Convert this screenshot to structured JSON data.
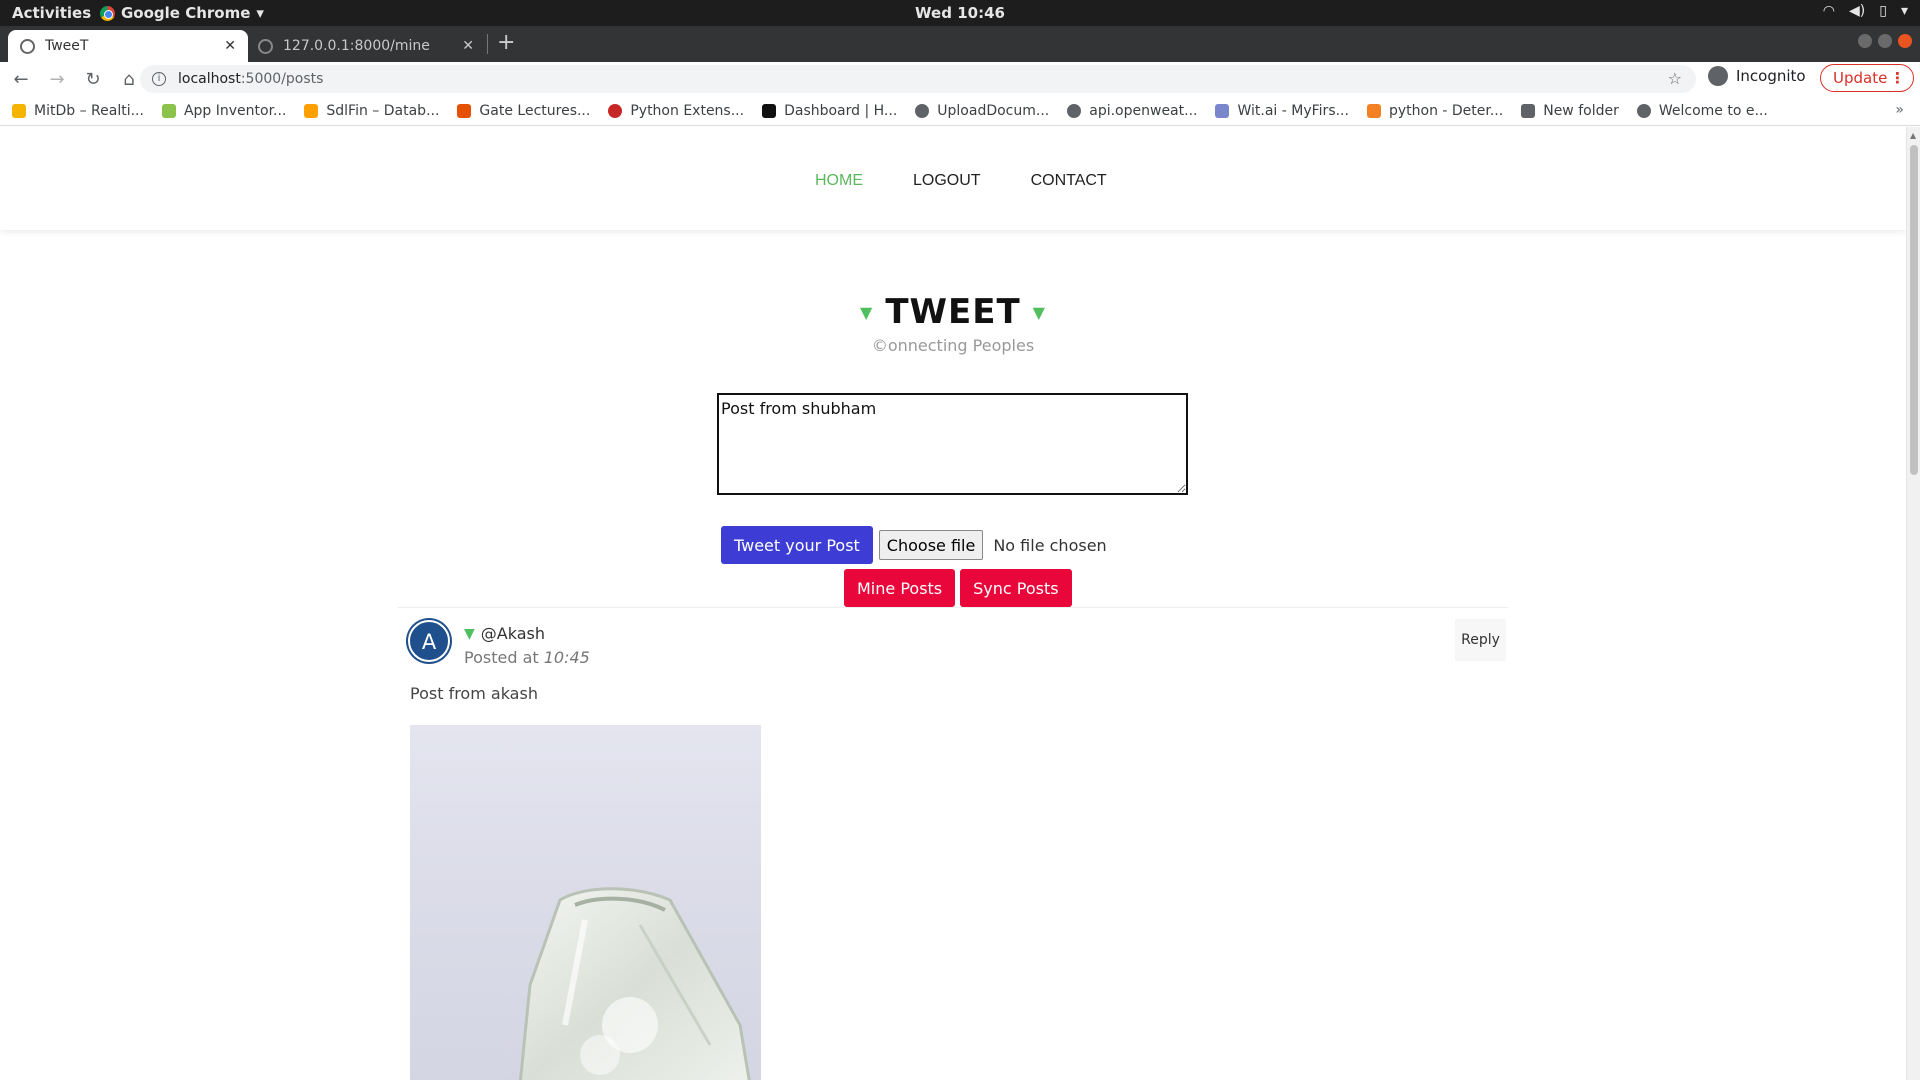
{
  "system": {
    "activities": "Activities",
    "app_name": "Google Chrome",
    "clock": "Wed 10:46"
  },
  "tabs": [
    {
      "label": "TweeT",
      "active": true
    },
    {
      "label": "127.0.0.1:8000/mine",
      "active": false
    }
  ],
  "toolbar": {
    "url_host": "localhost",
    "url_path": ":5000/posts",
    "incognito_label": "Incognito",
    "update_label": "Update"
  },
  "bookmarks": [
    {
      "label": "MitDb – Realti...",
      "color": "#f4b400"
    },
    {
      "label": "App Inventor...",
      "color": "#8bc34a"
    },
    {
      "label": "SdlFin – Datab...",
      "color": "#ffa000"
    },
    {
      "label": "Gate Lectures...",
      "color": "#e65100"
    },
    {
      "label": "Python Extens...",
      "color": "#c62828"
    },
    {
      "label": "Dashboard | H...",
      "color": "#111111"
    },
    {
      "label": "UploadDocum...",
      "color": "#5f6368"
    },
    {
      "label": "api.openweat...",
      "color": "#5f6368"
    },
    {
      "label": "Wit.ai - MyFirs...",
      "color": "#7986cb"
    },
    {
      "label": "python - Deter...",
      "color": "#f48024"
    },
    {
      "label": "New folder",
      "color": "#5f6368"
    },
    {
      "label": "Welcome to e...",
      "color": "#5f6368"
    }
  ],
  "site_nav": {
    "home": "HOME",
    "logout": "LOGOUT",
    "contact": "CONTACT"
  },
  "brand": {
    "title": "TWEET",
    "tagline": "©onnecting Peoples"
  },
  "composer": {
    "value": "Post from shubham"
  },
  "actions": {
    "tweet_button": "Tweet your Post",
    "choose_file": "Choose file",
    "file_status": "No file chosen",
    "mine_posts": "Mine Posts",
    "sync_posts": "Sync Posts"
  },
  "post": {
    "avatar_letter": "A",
    "handle": "@Akash",
    "posted_prefix": "Posted at",
    "posted_time": "10:45",
    "reply": "Reply",
    "text": "Post from akash"
  },
  "colors": {
    "accent_green": "#5cb85c",
    "primary_blue": "#3d3dd6",
    "danger_red": "#e8063a"
  }
}
